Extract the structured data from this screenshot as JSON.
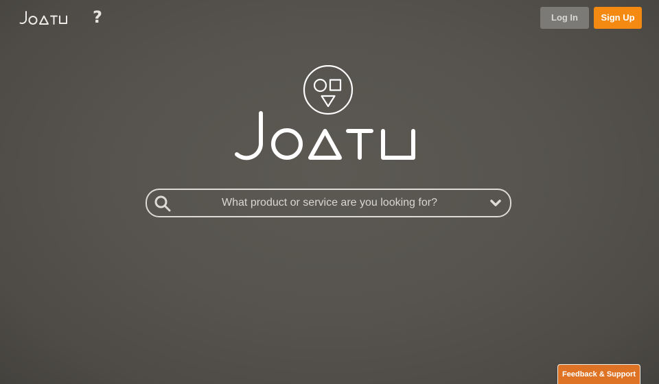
{
  "header": {
    "logo_text": "JOATU",
    "help_label": "?",
    "login_label": "Log In",
    "signup_label": "Sign Up"
  },
  "hero": {
    "wordmark_text": "JOATU",
    "emblem_icon": "circle-square-triangle-emblem"
  },
  "search": {
    "icon": "search-icon",
    "placeholder": "What product or service are you looking for?",
    "dropdown_icon": "chevron-down-icon"
  },
  "feedback": {
    "label": "Feedback & Support"
  },
  "colors": {
    "background": "#57544f",
    "signup": "#f48a12",
    "login": "#7c7a77",
    "feedback": "#de7325",
    "foreground": "#ffffff"
  }
}
